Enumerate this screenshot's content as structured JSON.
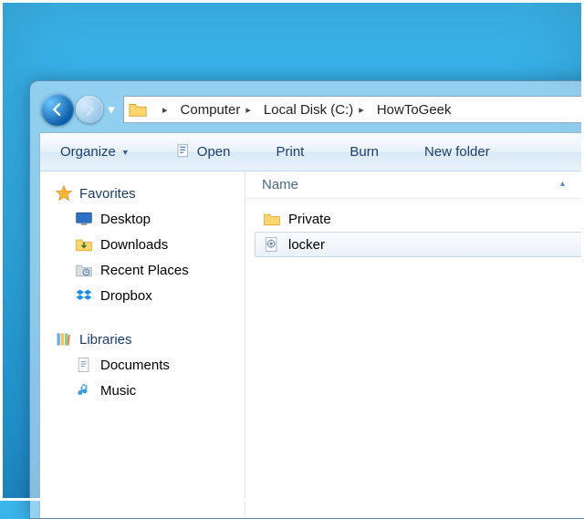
{
  "breadcrumb": {
    "items": [
      {
        "label": "Computer"
      },
      {
        "label": "Local Disk (C:)"
      },
      {
        "label": "HowToGeek"
      }
    ]
  },
  "toolbar": {
    "organize": "Organize",
    "open": "Open",
    "print": "Print",
    "burn": "Burn",
    "new_folder": "New folder"
  },
  "sidebar": {
    "favorites": {
      "label": "Favorites",
      "items": [
        {
          "label": "Desktop"
        },
        {
          "label": "Downloads"
        },
        {
          "label": "Recent Places"
        },
        {
          "label": "Dropbox"
        }
      ]
    },
    "libraries": {
      "label": "Libraries",
      "items": [
        {
          "label": "Documents"
        },
        {
          "label": "Music"
        }
      ]
    }
  },
  "content": {
    "column": "Name",
    "rows": [
      {
        "name": "Private",
        "type": "folder",
        "selected": false
      },
      {
        "name": "locker",
        "type": "batch",
        "selected": true
      }
    ]
  },
  "icons": {
    "star": "star-icon",
    "desktop": "desktop-icon",
    "downloads": "downloads-folder-icon",
    "recent": "recent-places-icon",
    "dropbox": "dropbox-icon",
    "libraries": "libraries-icon",
    "documents": "documents-icon",
    "music": "music-icon",
    "folder": "folder-icon",
    "batch": "batch-file-icon",
    "open": "open-file-icon"
  }
}
